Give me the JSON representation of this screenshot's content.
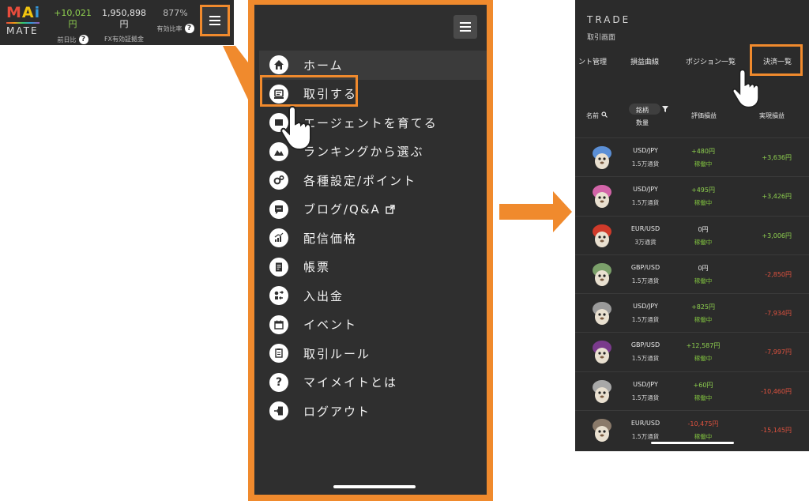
{
  "topbar": {
    "logo_top": "MAi",
    "logo_bottom": "MATE",
    "stats": [
      {
        "value": "+10,021円",
        "label": "前日比",
        "has_help": true,
        "color": "#8fd14f"
      },
      {
        "value": "1,950,898円",
        "label": "FX有効証拠金",
        "has_help": false,
        "color": "#e8e8e8"
      },
      {
        "value": "877%",
        "label": "有効比率",
        "has_help": true,
        "color": "#bdbdbd"
      }
    ]
  },
  "menu": {
    "items": [
      {
        "label": "ホーム",
        "icon": "home-icon"
      },
      {
        "label": "取引する",
        "icon": "trade-icon"
      },
      {
        "label": "エージェントを育てる",
        "icon": "agent-icon"
      },
      {
        "label": "ランキングから選ぶ",
        "icon": "ranking-icon"
      },
      {
        "label": "各種設定/ポイント",
        "icon": "settings-icon"
      },
      {
        "label": "ブログ/Q&A",
        "icon": "blog-icon"
      },
      {
        "label": "配信価格",
        "icon": "price-chart-icon"
      },
      {
        "label": "帳票",
        "icon": "report-icon"
      },
      {
        "label": "入出金",
        "icon": "transfer-icon"
      },
      {
        "label": "イベント",
        "icon": "calendar-icon"
      },
      {
        "label": "取引ルール",
        "icon": "rules-icon"
      },
      {
        "label": "マイメイトとは",
        "icon": "question-icon"
      },
      {
        "label": "ログアウト",
        "icon": "logout-icon"
      }
    ]
  },
  "trade": {
    "title": "TRADE",
    "subtitle": "取引画面",
    "tabs": [
      "ント管理",
      "損益曲線",
      "ポジション一覧",
      "決済一覧"
    ],
    "headers": {
      "name": "名前",
      "symbol": "銘柄",
      "quantity": "数量",
      "eval": "評価損益",
      "realized": "実現損益"
    },
    "rows": [
      {
        "pair": "USD/JPY",
        "lot": "1.5万通貨",
        "eval": "+480円",
        "status": "稼働中",
        "realized": "+3,636円",
        "eval_sign": "pos",
        "real_sign": "pos",
        "avatar_color": "#5b8fd6"
      },
      {
        "pair": "USD/JPY",
        "lot": "1.5万通貨",
        "eval": "+495円",
        "status": "稼働中",
        "realized": "+3,426円",
        "eval_sign": "pos",
        "real_sign": "pos",
        "avatar_color": "#d264a8"
      },
      {
        "pair": "EUR/USD",
        "lot": "3万通貨",
        "eval": "0円",
        "status": "稼働中",
        "realized": "+3,006円",
        "eval_sign": "zero",
        "real_sign": "pos",
        "avatar_color": "#d03a2a"
      },
      {
        "pair": "GBP/USD",
        "lot": "1.5万通貨",
        "eval": "0円",
        "status": "稼働中",
        "realized": "-2,850円",
        "eval_sign": "zero",
        "real_sign": "neg",
        "avatar_color": "#7ba06a"
      },
      {
        "pair": "USD/JPY",
        "lot": "1.5万通貨",
        "eval": "+825円",
        "status": "稼働中",
        "realized": "-7,934円",
        "eval_sign": "pos",
        "real_sign": "neg",
        "avatar_color": "#9a9a9a"
      },
      {
        "pair": "GBP/USD",
        "lot": "1.5万通貨",
        "eval": "+12,587円",
        "status": "稼働中",
        "realized": "-7,997円",
        "eval_sign": "pos",
        "real_sign": "neg",
        "avatar_color": "#7a3a8c"
      },
      {
        "pair": "USD/JPY",
        "lot": "1.5万通貨",
        "eval": "+60円",
        "status": "稼働中",
        "realized": "-10,460円",
        "eval_sign": "pos",
        "real_sign": "neg",
        "avatar_color": "#a8a8a8"
      },
      {
        "pair": "EUR/USD",
        "lot": "1.5万通貨",
        "eval": "-10,475円",
        "status": "稼働中",
        "realized": "-15,145円",
        "eval_sign": "neg",
        "real_sign": "neg",
        "avatar_color": "#8a7a6a"
      }
    ]
  },
  "colors": {
    "accent": "#f08a2d",
    "positive": "#8fd14f",
    "negative": "#e0523f",
    "panel": "#2f2f2f"
  }
}
